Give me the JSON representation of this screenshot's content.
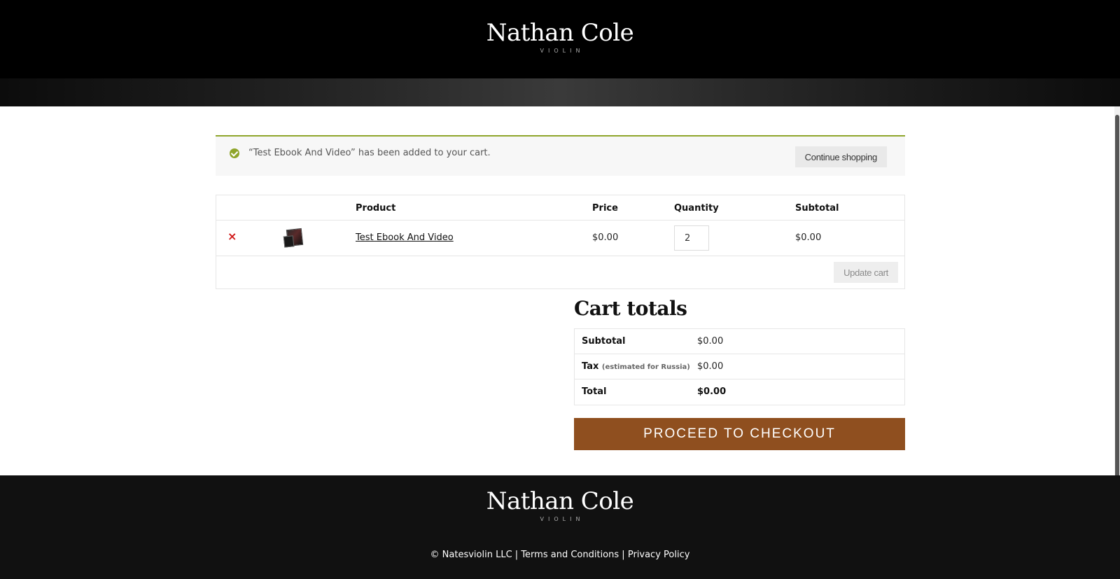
{
  "header": {
    "logo_name": "Nathan Cole",
    "logo_sub": "VIOLIN"
  },
  "notice": {
    "message": "“Test Ebook And Video” has been added to your cart.",
    "continue_label": "Continue shopping"
  },
  "cart": {
    "columns": [
      "",
      "",
      "Product",
      "Price",
      "Quantity",
      "Subtotal"
    ],
    "items": [
      {
        "remove": "×",
        "product": "Test Ebook And Video",
        "price": "$0.00",
        "quantity": "2",
        "subtotal": "$0.00"
      }
    ],
    "update_label": "Update cart"
  },
  "totals": {
    "title": "Cart totals",
    "subtotal_label": "Subtotal",
    "subtotal_value": "$0.00",
    "tax_label": "Tax",
    "tax_note": "(estimated for Russia)",
    "tax_value": "$0.00",
    "total_label": "Total",
    "total_value": "$0.00",
    "checkout_label": "PROCEED TO CHECKOUT"
  },
  "footer": {
    "logo_name": "Nathan Cole",
    "logo_sub": "VIOLIN",
    "copyright": "© Natesviolin LLC",
    "separator": "|",
    "terms": "Terms and Conditions",
    "privacy": "Privacy Policy"
  },
  "colors": {
    "notice_accent": "#8fa52b",
    "checkout_button": "#8f4f1f",
    "remove_icon": "#d01616"
  }
}
